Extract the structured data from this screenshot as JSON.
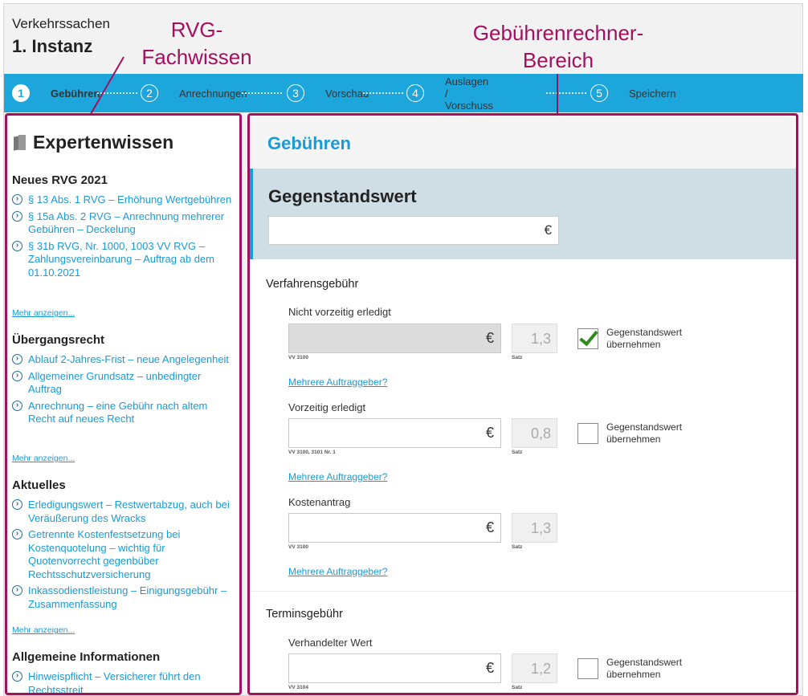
{
  "header": {
    "subtitle": "Verkehrssachen",
    "title": "1. Instanz"
  },
  "annotations": {
    "rvg": [
      "RVG-",
      "Fachwissen"
    ],
    "calc": [
      "Gebührenrechner-",
      "Bereich"
    ]
  },
  "steps": [
    {
      "num": "1",
      "label": "Gebühren",
      "active": true
    },
    {
      "num": "2",
      "label": "Anrechnungen",
      "active": false
    },
    {
      "num": "3",
      "label": "Vorschau",
      "active": false
    },
    {
      "num": "4",
      "label": "Auslagen / Vorschuss",
      "active": false
    },
    {
      "num": "5",
      "label": "Speichern",
      "active": false
    }
  ],
  "sidebar": {
    "title": "Expertenwissen",
    "more_label": "Mehr anzeigen...",
    "sections": [
      {
        "heading": "Neues RVG 2021",
        "links": [
          "§ 13 Abs. 1 RVG – Erhöhung Wertgebühren",
          "§ 15a Abs. 2 RVG – Anrechnung mehrerer Gebühren – Deckelung",
          "§ 31b RVG, Nr. 1000, 1003 VV RVG – Zahlungsvereinbarung – Auftrag ab dem 01.10.2021"
        ]
      },
      {
        "heading": "Übergangsrecht",
        "links": [
          "Ablauf 2-Jahres-Frist – neue Angelegenheit",
          "Allgemeiner Grundsatz – unbedingter Auftrag",
          "Anrechnung – eine Gebühr nach altem Recht auf neues Recht"
        ]
      },
      {
        "heading": "Aktuelles",
        "links": [
          "Erledigungswert – Restwertabzug, auch bei Veräußerung des Wracks",
          "Getrennte Kostenfestsetzung bei Kostenquotelung – wichtig für Quotenvorrecht gegenbüber Rechtsschutzversicherung",
          "Inkassodienstleistung – Einigungsgebühr – Zusammenfassung"
        ]
      },
      {
        "heading": "Allgemeine Informationen",
        "links": [
          "Hinweispflicht – Versicherer führt den Rechtsstreit"
        ]
      }
    ]
  },
  "main": {
    "heading": "Gebühren",
    "gegenstandswert": {
      "label": "Gegenstandswert",
      "value": "",
      "currency": "€"
    },
    "verfahren": {
      "heading": "Verfahrensgebühr",
      "rows": [
        {
          "label": "Nicht vorzeitig erledigt",
          "vv": "VV 3100",
          "satz": "1,3",
          "satz_label": "Satz",
          "checked": true,
          "disabled": true
        },
        {
          "label": "Vorzeitig erledigt",
          "vv": "VV 3100, 3101 Nr. 1",
          "satz": "0,8",
          "satz_label": "Satz",
          "checked": false,
          "disabled": false
        },
        {
          "label": "Kostenantrag",
          "vv": "VV 3100",
          "satz": "1,3",
          "satz_label": "Satz",
          "checked": null,
          "disabled": false
        }
      ]
    },
    "termin": {
      "heading": "Terminsgebühr",
      "rows": [
        {
          "label": "Verhandelter Wert",
          "vv": "VV 3104",
          "satz": "1,2",
          "satz_label": "Satz",
          "checked": false,
          "disabled": false
        }
      ]
    },
    "currency": "€",
    "checkbox_label": [
      "Gegenstandswert",
      "übernehmen"
    ],
    "mehrere_label": "Mehrere Auftraggeber?"
  }
}
